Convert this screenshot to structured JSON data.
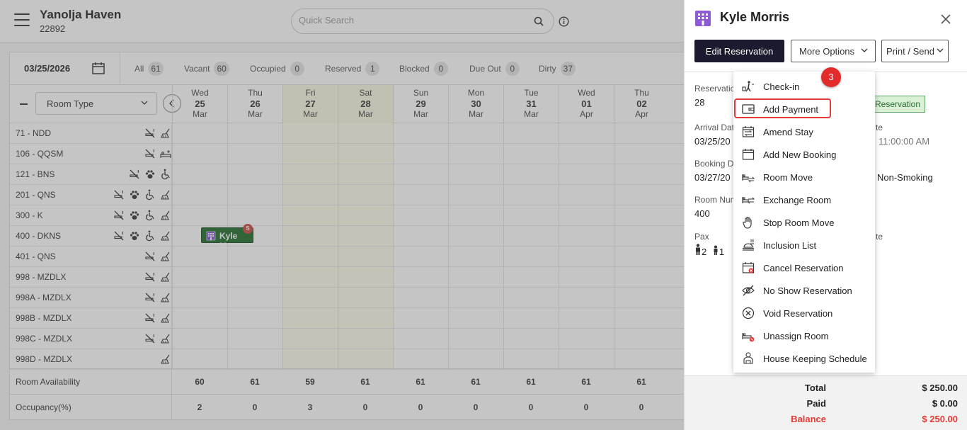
{
  "header": {
    "property_name": "Yanolja Haven",
    "property_id": "22892",
    "search_placeholder": "Quick Search"
  },
  "filters": {
    "date": "03/25/2026",
    "items": [
      {
        "label": "All",
        "count": "61"
      },
      {
        "label": "Vacant",
        "count": "60"
      },
      {
        "label": "Occupied",
        "count": "0"
      },
      {
        "label": "Reserved",
        "count": "1"
      },
      {
        "label": "Blocked",
        "count": "0"
      },
      {
        "label": "Due Out",
        "count": "0"
      },
      {
        "label": "Dirty",
        "count": "37"
      }
    ]
  },
  "grid": {
    "room_type_label": "Room Type",
    "days": [
      {
        "dow": "Wed",
        "day": "25",
        "mon": "Mar",
        "weekend": false
      },
      {
        "dow": "Thu",
        "day": "26",
        "mon": "Mar",
        "weekend": false
      },
      {
        "dow": "Fri",
        "day": "27",
        "mon": "Mar",
        "weekend": true
      },
      {
        "dow": "Sat",
        "day": "28",
        "mon": "Mar",
        "weekend": true
      },
      {
        "dow": "Sun",
        "day": "29",
        "mon": "Mar",
        "weekend": false
      },
      {
        "dow": "Mon",
        "day": "30",
        "mon": "Mar",
        "weekend": false
      },
      {
        "dow": "Tue",
        "day": "31",
        "mon": "Mar",
        "weekend": false
      },
      {
        "dow": "Wed",
        "day": "01",
        "mon": "Apr",
        "weekend": false
      },
      {
        "dow": "Thu",
        "day": "02",
        "mon": "Apr",
        "weekend": false
      }
    ],
    "rooms": [
      {
        "label": "71 - NDD",
        "icons": [
          "no-smoking-icon",
          "broom-icon"
        ]
      },
      {
        "label": "106 - QQSM",
        "icons": [
          "no-smoking-icon",
          "bed-icon"
        ]
      },
      {
        "label": "121 - BNS",
        "icons": [
          "no-smoking-icon",
          "paw-icon",
          "wheelchair-icon"
        ]
      },
      {
        "label": "201 - QNS",
        "icons": [
          "no-smoking-icon",
          "paw-icon",
          "wheelchair-icon",
          "broom-icon"
        ]
      },
      {
        "label": "300 - K",
        "icons": [
          "no-smoking-icon",
          "paw-icon",
          "wheelchair-icon",
          "broom-icon"
        ]
      },
      {
        "label": "400 - DKNS",
        "icons": [
          "no-smoking-icon",
          "paw-icon",
          "wheelchair-icon",
          "broom-icon"
        ]
      },
      {
        "label": "401 - QNS",
        "icons": [
          "no-smoking-icon",
          "broom-icon"
        ]
      },
      {
        "label": "998 - MZDLX",
        "icons": [
          "no-smoking-icon",
          "broom-icon"
        ]
      },
      {
        "label": "998A - MZDLX",
        "icons": [
          "no-smoking-icon",
          "broom-icon"
        ]
      },
      {
        "label": "998B - MZDLX",
        "icons": [
          "no-smoking-icon",
          "broom-icon"
        ]
      },
      {
        "label": "998C - MZDLX",
        "icons": [
          "no-smoking-icon",
          "broom-icon"
        ]
      },
      {
        "label": "998D - MZDLX",
        "icons": [
          "broom-icon"
        ]
      }
    ],
    "reservation": {
      "label": "Kyle M...",
      "badge": "S"
    },
    "availability": {
      "label": "Room Availability",
      "values": [
        "60",
        "61",
        "59",
        "61",
        "61",
        "61",
        "61",
        "61",
        "61"
      ]
    },
    "occupancy": {
      "label": "Occupancy(%)",
      "values": [
        "2",
        "0",
        "3",
        "0",
        "0",
        "0",
        "0",
        "0",
        "0"
      ]
    }
  },
  "panel": {
    "guest_name": "Kyle Morris",
    "edit_label": "Edit Reservation",
    "more_label": "More Options",
    "print_label": "Print / Send",
    "fields": [
      {
        "label": "Reservation",
        "value": "28"
      },
      {
        "label": "Arrival Dat",
        "value": "03/25/20"
      },
      {
        "label": "Booking Da",
        "value": "03/27/20"
      },
      {
        "label": "Room Num",
        "value": "400"
      },
      {
        "label": "Pax",
        "value": ""
      }
    ],
    "right_fields": [
      {
        "label": "te",
        "value": "11:00:00 AM"
      },
      {
        "label": "",
        "value": "Non-Smoking"
      },
      {
        "label": "te",
        "value": ""
      }
    ],
    "status_tag": "Reservation",
    "pax_adults": "2",
    "pax_children": "1",
    "totals": [
      {
        "label": "Total",
        "value": "$ 250.00",
        "color": "#222222"
      },
      {
        "label": "Paid",
        "value": "$ 0.00",
        "color": "#222222"
      },
      {
        "label": "Balance",
        "value": "$ 250.00",
        "color": "#e53935"
      }
    ]
  },
  "menu": {
    "step": "3",
    "items": [
      {
        "label": "Check-in",
        "icon": "check-in-icon"
      },
      {
        "label": "Add Payment",
        "icon": "wallet-icon"
      },
      {
        "label": "Amend Stay",
        "icon": "calendar-swap-icon"
      },
      {
        "label": "Add New Booking",
        "icon": "calendar-icon"
      },
      {
        "label": "Room Move",
        "icon": "bed-move-icon"
      },
      {
        "label": "Exchange Room",
        "icon": "bed-exchange-icon"
      },
      {
        "label": "Stop Room Move",
        "icon": "hand-stop-icon"
      },
      {
        "label": "Inclusion List",
        "icon": "inclusion-icon"
      },
      {
        "label": "Cancel Reservation",
        "icon": "calendar-cancel-icon"
      },
      {
        "label": "No Show Reservation",
        "icon": "eye-off-icon"
      },
      {
        "label": "Void Reservation",
        "icon": "circle-x-icon"
      },
      {
        "label": "Unassign Room",
        "icon": "bed-unassign-icon"
      },
      {
        "label": "House Keeping Schedule",
        "icon": "housekeeping-icon"
      }
    ]
  }
}
